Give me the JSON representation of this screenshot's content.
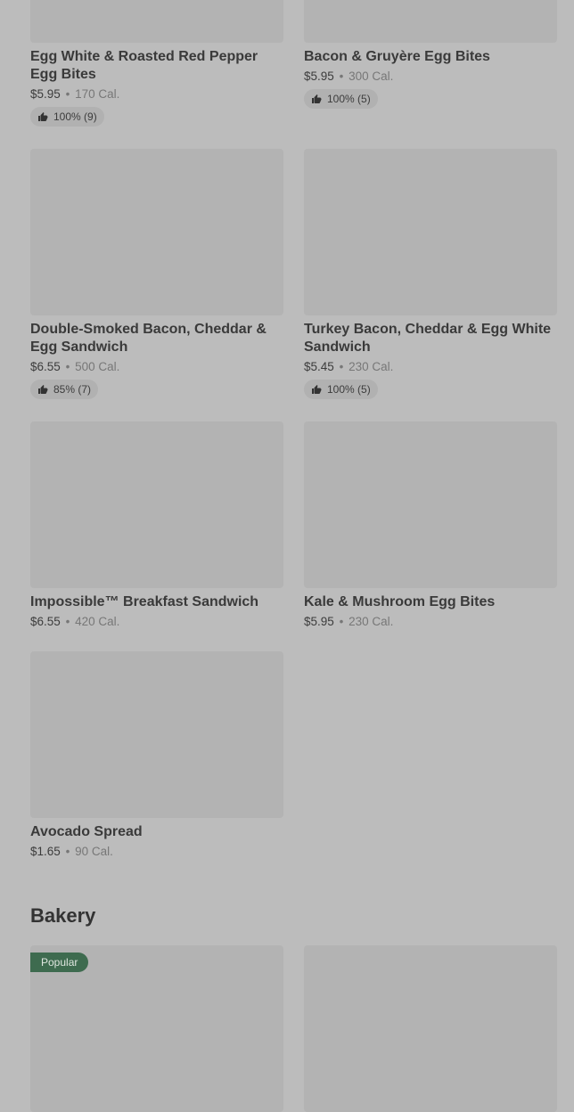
{
  "items": [
    {
      "name": "Egg White & Roasted Red Pepper Egg Bites",
      "price": "$5.95",
      "cal": "170 Cal.",
      "rating": "100% (9)"
    },
    {
      "name": "Bacon & Gruyère Egg Bites",
      "price": "$5.95",
      "cal": "300 Cal.",
      "rating": "100% (5)"
    },
    {
      "name": "Double-Smoked Bacon, Cheddar & Egg Sandwich",
      "price": "$6.55",
      "cal": "500 Cal.",
      "rating": "85% (7)"
    },
    {
      "name": "Turkey Bacon, Cheddar & Egg White Sandwich",
      "price": "$5.45",
      "cal": "230 Cal.",
      "rating": "100% (5)"
    },
    {
      "name": "Impossible™ Breakfast Sandwich",
      "price": "$6.55",
      "cal": "420 Cal."
    },
    {
      "name": "Kale & Mushroom Egg Bites",
      "price": "$5.95",
      "cal": "230 Cal."
    },
    {
      "name": "Avocado Spread",
      "price": "$1.65",
      "cal": "90 Cal."
    }
  ],
  "sections": {
    "bakery": {
      "title": "Bakery",
      "badge": "Popular"
    }
  },
  "separator": "•"
}
